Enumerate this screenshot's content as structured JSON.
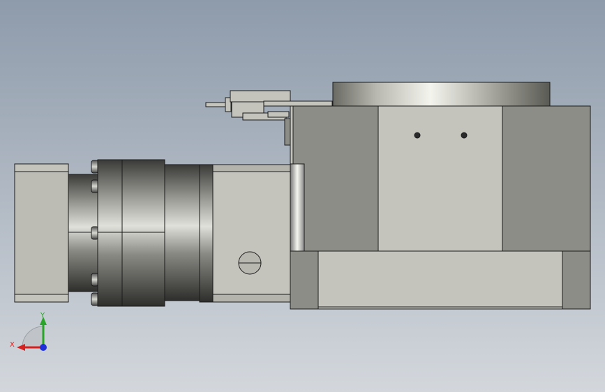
{
  "scene": {
    "background_top": "#8e9bab",
    "background_bottom": "#d2d6db",
    "part_fill": "#c4c4bc",
    "shadow_fill": "#8c8c86",
    "edge_color": "#1a1a1a"
  },
  "triad": {
    "x_label": "X",
    "y_label": "Y",
    "x_color": "#d62020",
    "y_color": "#2aa52a",
    "z_color": "#2030d8"
  },
  "icons": {
    "coordinate_triad": "xyz-axis-triad"
  }
}
